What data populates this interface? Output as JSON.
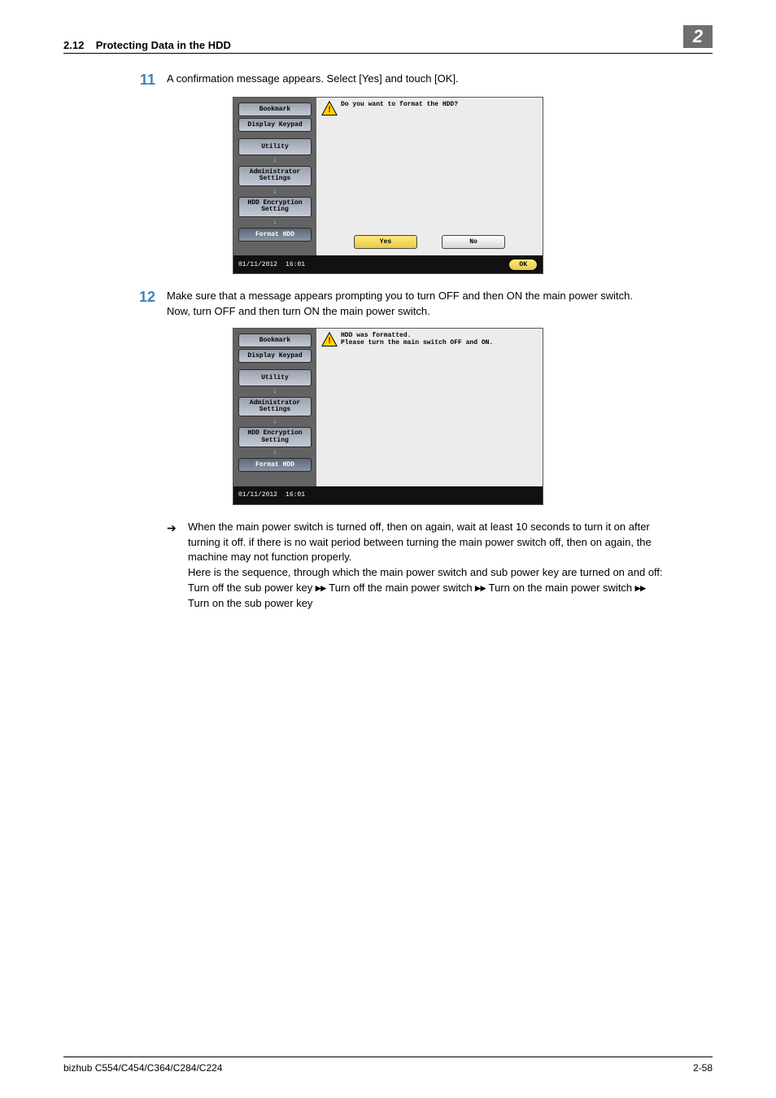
{
  "header": {
    "section": "2.12",
    "title": "Protecting Data in the HDD",
    "chapter": "2"
  },
  "steps": {
    "s11": {
      "num": "11",
      "text": "A confirmation message appears. Select [Yes] and touch [OK]."
    },
    "s12": {
      "num": "12",
      "line1": "Make sure that a message appears prompting you to turn OFF and then ON the main power switch.",
      "line2": "Now, turn OFF and then turn ON the main power switch."
    }
  },
  "note": {
    "p1": "When the main power switch is turned off, then on again, wait at least 10 seconds to turn it on after turning it off. if there is no wait period between turning the main power switch off, then on again, the machine may not function properly.",
    "p2": "Here is the sequence, through which the main power switch and sub power key are turned on and off:",
    "seq_a": "Turn off the sub power key ",
    "seq_b": " Turn off the main power switch ",
    "seq_c": " Turn on the main power switch ",
    "seq_d": "Turn on the sub power key",
    "sym": "▸▸"
  },
  "shot1": {
    "msg": "Do you want to format the HDD?",
    "sidebar": {
      "bookmark": "Bookmark",
      "keypad": "Display Keypad",
      "utility": "Utility",
      "admin": "Administrator Settings",
      "enc": "HDD Encryption Setting",
      "format": "Format HDD"
    },
    "yes": "Yes",
    "no": "No",
    "date": "01/11/2012",
    "time": "16:01",
    "ok": "OK"
  },
  "shot2": {
    "msg1": "HDD was formatted.",
    "msg2": "Please turn the main switch OFF and ON.",
    "sidebar": {
      "bookmark": "Bookmark",
      "keypad": "Display Keypad",
      "utility": "Utility",
      "admin": "Administrator Settings",
      "enc": "HDD Encryption Setting",
      "format": "Format HDD"
    },
    "date": "01/11/2012",
    "time": "16:01"
  },
  "footer": {
    "left": "bizhub C554/C454/C364/C284/C224",
    "right": "2-58"
  }
}
